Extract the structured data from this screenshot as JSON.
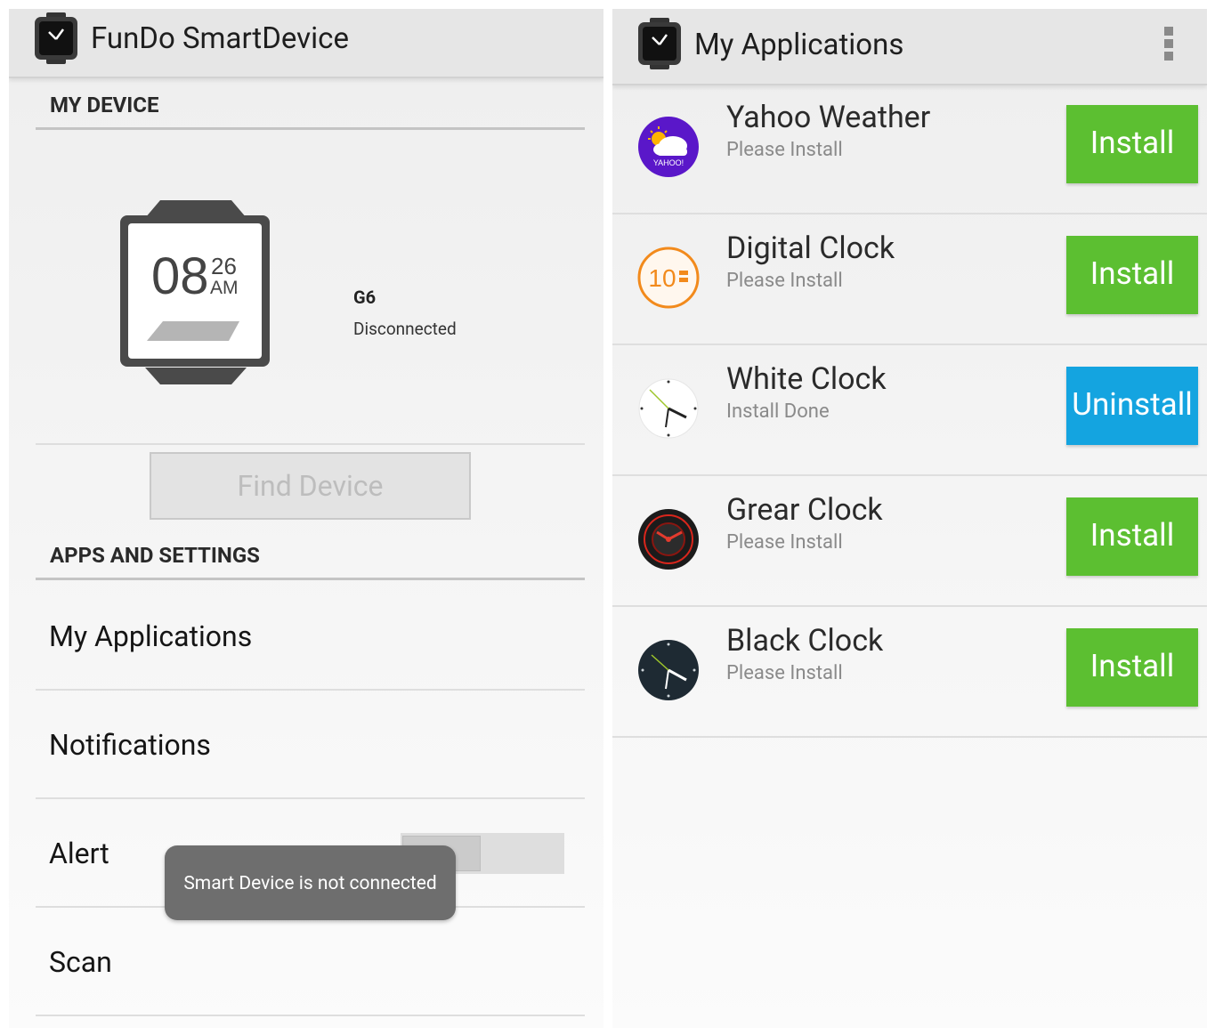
{
  "left_screen": {
    "app_title": "FunDo SmartDevice",
    "section_my_device": "MY DEVICE",
    "watch_display": {
      "hour": "08",
      "minute": "26",
      "ampm": "AM"
    },
    "device_name": "G6",
    "device_status": "Disconnected",
    "find_device_label": "Find Device",
    "section_apps_settings": "APPS AND SETTINGS",
    "menu": [
      "My Applications",
      "Notifications",
      "Alert",
      "Scan"
    ],
    "toast": "Smart Device is not connected",
    "colors": {
      "appbar": "#e6e6e6",
      "toast": "#6e6e6e"
    }
  },
  "right_screen": {
    "title": "My Applications",
    "apps": [
      {
        "name": "Yahoo Weather",
        "status": "Please Install",
        "action": "Install",
        "icon": "yahoo-weather-icon",
        "icon_text": "YAHOO!"
      },
      {
        "name": "Digital Clock",
        "status": "Please Install",
        "action": "Install",
        "icon": "digital-clock-icon",
        "icon_text": "10"
      },
      {
        "name": "White Clock",
        "status": "Install Done",
        "action": "Uninstall",
        "icon": "white-clock-icon"
      },
      {
        "name": "Grear Clock",
        "status": "Please Install",
        "action": "Install",
        "icon": "gear-clock-icon"
      },
      {
        "name": "Black Clock",
        "status": "Please Install",
        "action": "Install",
        "icon": "black-clock-icon"
      }
    ],
    "colors": {
      "install": "#5cbf31",
      "uninstall": "#14a4e0"
    }
  }
}
